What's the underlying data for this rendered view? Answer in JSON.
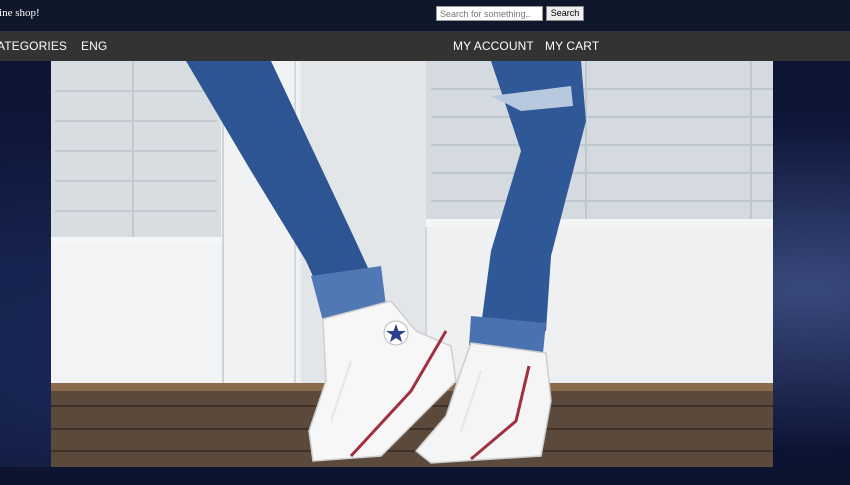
{
  "header": {
    "welcome_text": "line shop!",
    "search": {
      "placeholder": "Search for something..",
      "value": ""
    },
    "search_button_label": "Search"
  },
  "nav": {
    "left_items": [
      "ATEGORIES",
      "ENG"
    ],
    "right_items": [
      "MY ACCOUNT",
      "MY CART"
    ]
  },
  "hero": {
    "image_subject": "legs in ripped blue jeans wearing white high-top sneakers on a wooden porch"
  },
  "colors": {
    "topbar": "#0f172b",
    "navbar": "#333333",
    "nav_text": "#ffffff",
    "page_background": "#0d1530"
  }
}
